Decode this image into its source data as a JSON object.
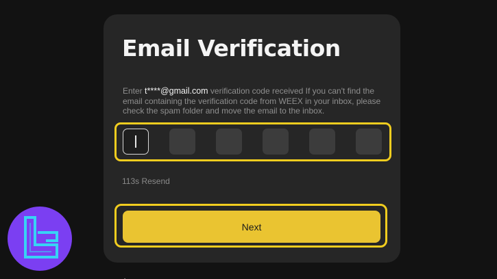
{
  "card": {
    "title": "Email Verification",
    "description_prefix": "Enter ",
    "email": "t****@gmail.com",
    "description_suffix": " verification code received If you can't find the email containing the verification code from WEEX in your inbox, please check the spam folder and move the email to the inbox."
  },
  "otp": {
    "digits": [
      "",
      "",
      "",
      "",
      "",
      ""
    ],
    "active_index": 0
  },
  "resend_text": "113s Resend",
  "next_button": {
    "label": "Next"
  },
  "colors": {
    "background": "#121212",
    "card": "#262626",
    "accent_yellow": "#eac431",
    "highlight": "#f2cd1f",
    "logo_purple": "#7b3ff2",
    "logo_cyan": "#37d3f5"
  },
  "icons": {
    "logo": "brand-logo-icon",
    "pointer": "mouse-pointer-icon"
  }
}
